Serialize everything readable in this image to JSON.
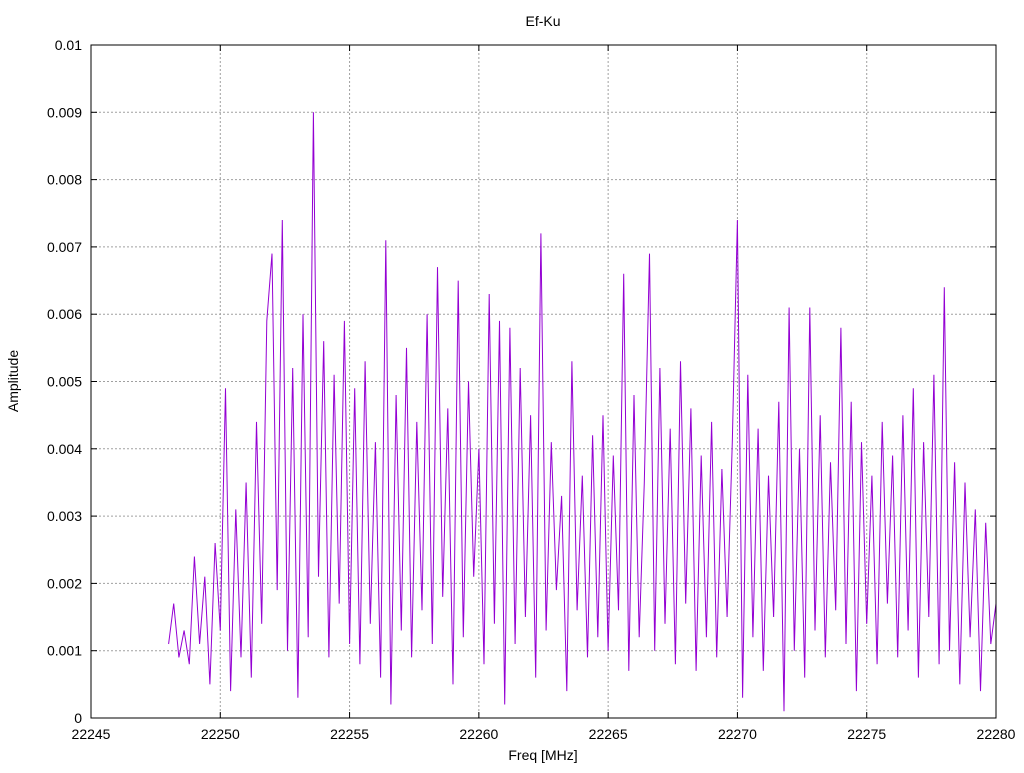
{
  "chart_data": {
    "type": "line",
    "title": "Ef-Ku",
    "xlabel": "Freq [MHz]",
    "ylabel": "Amplitude",
    "xlim": [
      22245,
      22280
    ],
    "ylim": [
      0,
      0.01
    ],
    "grid": true,
    "legend": "none",
    "xticks": [
      "22245",
      "22250",
      "22255",
      "22260",
      "22265",
      "22270",
      "22275",
      "22280"
    ],
    "yticks": [
      "0",
      "0.001",
      "0.002",
      "0.003",
      "0.004",
      "0.005",
      "0.006",
      "0.007",
      "0.008",
      "0.009",
      "0.01"
    ],
    "series": [
      {
        "name": "Ef-Ku",
        "color": "#9400d3",
        "x_start": 22248.0,
        "x_step": 0.2,
        "values": [
          0.0011,
          0.0017,
          0.0009,
          0.0013,
          0.0008,
          0.0024,
          0.0011,
          0.0021,
          0.0005,
          0.0026,
          0.0013,
          0.0049,
          0.0004,
          0.0031,
          0.0009,
          0.0035,
          0.0006,
          0.0044,
          0.0014,
          0.0059,
          0.0069,
          0.0019,
          0.0074,
          0.001,
          0.0052,
          0.0003,
          0.006,
          0.0012,
          0.009,
          0.0021,
          0.0056,
          0.0009,
          0.0051,
          0.0017,
          0.0059,
          0.0011,
          0.0049,
          0.0008,
          0.0053,
          0.0014,
          0.0041,
          0.0006,
          0.0071,
          0.0002,
          0.0048,
          0.0013,
          0.0055,
          0.0009,
          0.0044,
          0.0016,
          0.006,
          0.0011,
          0.0067,
          0.0018,
          0.0046,
          0.0005,
          0.0065,
          0.0012,
          0.005,
          0.0021,
          0.004,
          0.0008,
          0.0063,
          0.0014,
          0.0059,
          0.0002,
          0.0058,
          0.0011,
          0.0052,
          0.0015,
          0.0045,
          0.0006,
          0.0072,
          0.0013,
          0.0041,
          0.0019,
          0.0033,
          0.0004,
          0.0053,
          0.0016,
          0.0036,
          0.0009,
          0.0042,
          0.0012,
          0.0045,
          0.001,
          0.0039,
          0.0016,
          0.0066,
          0.0007,
          0.0048,
          0.0012,
          0.0035,
          0.0069,
          0.001,
          0.0052,
          0.0014,
          0.0043,
          0.0008,
          0.0053,
          0.0017,
          0.0046,
          0.0007,
          0.0039,
          0.0012,
          0.0044,
          0.0009,
          0.0037,
          0.0015,
          0.0041,
          0.0074,
          0.0003,
          0.0051,
          0.0012,
          0.0043,
          0.0007,
          0.0036,
          0.0015,
          0.0047,
          0.0001,
          0.0061,
          0.001,
          0.004,
          0.0006,
          0.0061,
          0.0013,
          0.0045,
          0.0009,
          0.0038,
          0.0016,
          0.0058,
          0.0011,
          0.0047,
          0.0004,
          0.0041,
          0.0014,
          0.0036,
          0.0008,
          0.0044,
          0.0017,
          0.0039,
          0.0009,
          0.0045,
          0.0013,
          0.0049,
          0.0006,
          0.0041,
          0.0015,
          0.0051,
          0.0008,
          0.0064,
          0.001,
          0.0038,
          0.0005,
          0.0035,
          0.0012,
          0.0031,
          0.0004,
          0.0029,
          0.0011,
          0.0017
        ]
      }
    ]
  }
}
